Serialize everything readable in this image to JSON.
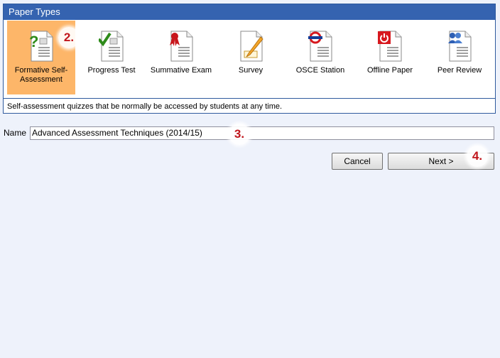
{
  "panel": {
    "title": "Paper Types",
    "selected": "formative",
    "description": "Self-assessment quizzes that be normally be accessed by students at any time."
  },
  "types": [
    {
      "id": "formative",
      "label": "Formative Self-Assessment",
      "icon": "question-document-icon"
    },
    {
      "id": "progress",
      "label": "Progress Test",
      "icon": "checkmark-document-icon"
    },
    {
      "id": "summative",
      "label": "Summative Exam",
      "icon": "ribbon-document-icon"
    },
    {
      "id": "survey",
      "label": "Survey",
      "icon": "pencil-document-icon"
    },
    {
      "id": "osce",
      "label": "OSCE Station",
      "icon": "roundel-document-icon"
    },
    {
      "id": "offline",
      "label": "Offline Paper",
      "icon": "power-document-icon"
    },
    {
      "id": "peer",
      "label": "Peer Review",
      "icon": "people-document-icon"
    }
  ],
  "form": {
    "name_label": "Name",
    "name_value": "Advanced Assessment Techniques (2014/15)"
  },
  "buttons": {
    "cancel": "Cancel",
    "next": "Next >"
  },
  "markers": {
    "m2": "2.",
    "m3": "3.",
    "m4": "4."
  },
  "colors": {
    "header": "#3563b0",
    "selected": "#fdb669",
    "background": "#eef2fb",
    "marker_text": "#c0161c"
  }
}
